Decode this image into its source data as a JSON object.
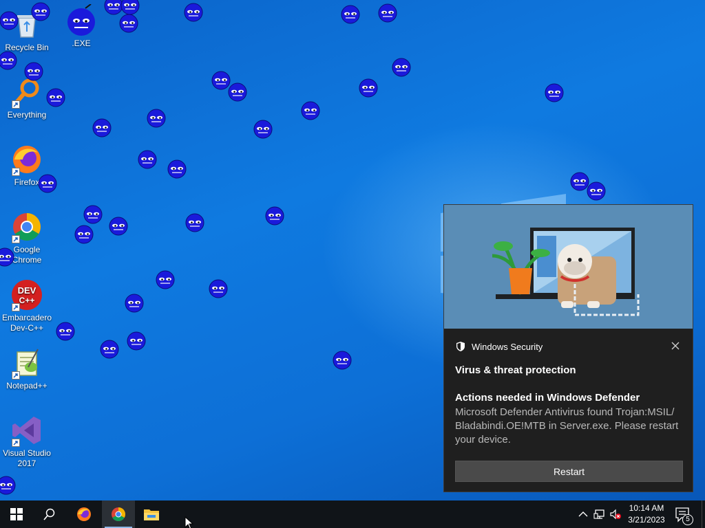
{
  "desktop": {
    "icons": [
      {
        "label": "Recycle Bin",
        "icon": "recycle-bin-icon"
      },
      {
        "label": ".EXE",
        "icon": "exe-blob-icon"
      },
      {
        "label": "Everything",
        "icon": "everything-search-icon"
      },
      {
        "label": "Firefox",
        "icon": "firefox-icon"
      },
      {
        "label": "Google Chrome",
        "icon": "chrome-icon"
      },
      {
        "label": "Embarcadero Dev-C++",
        "icon": "devcpp-icon"
      },
      {
        "label": "Notepad++",
        "icon": "notepadpp-icon"
      },
      {
        "label": "Visual Studio 2017",
        "icon": "visual-studio-icon"
      }
    ],
    "devcpp_badge_line1": "DEV",
    "devcpp_badge_line2": "C++"
  },
  "toast": {
    "app_name": "Windows Security",
    "title": "Virus & threat protection",
    "subtitle": "Actions needed in Windows Defender",
    "body": "Microsoft Defender Antivirus found Trojan:MSIL/ Bladabindi.OE!MTB in Server.exe. Please restart your device.",
    "button_label": "Restart",
    "icons": {
      "shield": "shield-icon",
      "close": "close-icon"
    }
  },
  "taskbar": {
    "buttons": [
      "start-icon",
      "search-icon",
      "firefox-icon",
      "chrome-icon",
      "file-explorer-icon"
    ],
    "tray": [
      "chevron-up-icon",
      "network-icon",
      "volume-muted-icon"
    ],
    "time": "10:14 AM",
    "date": "3/21/2023",
    "notification_count": "5"
  },
  "colors": {
    "desktop_bg": "#0f7ae0",
    "taskbar_bg": "#101418",
    "toast_bg": "#1f1f1f",
    "blob": "#1a1adb"
  }
}
